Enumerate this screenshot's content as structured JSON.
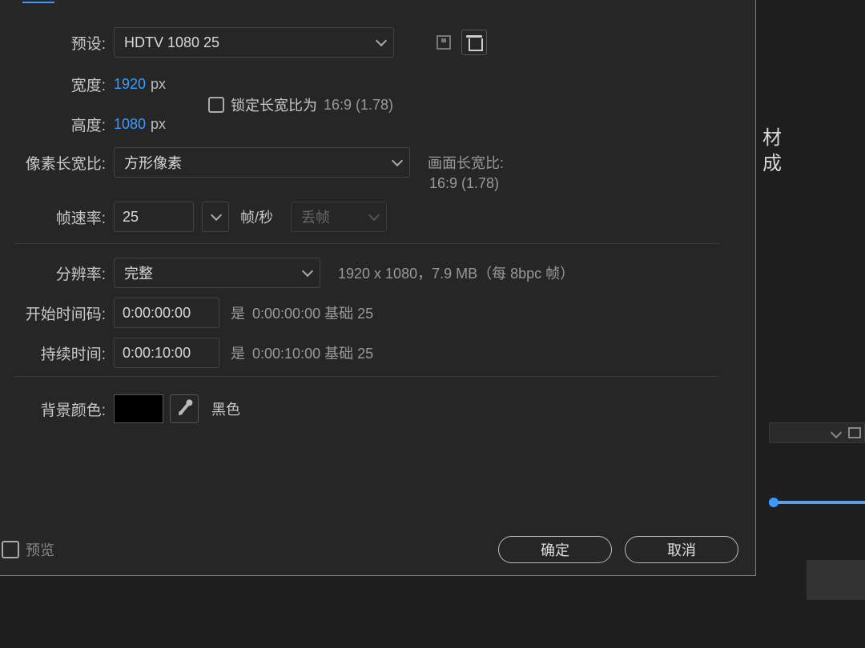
{
  "context": {
    "side_text_1": "材",
    "side_text_2": "成"
  },
  "preset": {
    "label": "预设:",
    "value": "HDTV 1080 25"
  },
  "width": {
    "label": "宽度:",
    "value": "1920",
    "unit": "px"
  },
  "height": {
    "label": "高度:",
    "value": "1080",
    "unit": "px"
  },
  "lock_aspect": {
    "label": "锁定长宽比为",
    "ratio": "16:9 (1.78)",
    "checked": false
  },
  "pixel_aspect": {
    "label": "像素长宽比:",
    "value": "方形像素",
    "frame_aspect_label": "画面长宽比:",
    "frame_aspect_value": "16:9 (1.78)"
  },
  "frame_rate": {
    "label": "帧速率:",
    "value": "25",
    "unit": "帧/秒",
    "drop_label": "丢帧"
  },
  "resolution": {
    "label": "分辨率:",
    "value": "完整",
    "info": "1920 x 1080，7.9 MB（每 8bpc 帧）"
  },
  "start_tc": {
    "label": "开始时间码:",
    "value": "0:00:00:00",
    "note_is": "是",
    "note_base": "0:00:00:00  基础 25"
  },
  "duration": {
    "label": "持续时间:",
    "value": "0:00:10:00",
    "note_is": "是",
    "note_base": "0:00:10:00  基础 25"
  },
  "bg_color": {
    "label": "背景颜色:",
    "swatch": "#000000",
    "name": "黑色"
  },
  "footer": {
    "preview": "预览",
    "ok": "确定",
    "cancel": "取消"
  }
}
